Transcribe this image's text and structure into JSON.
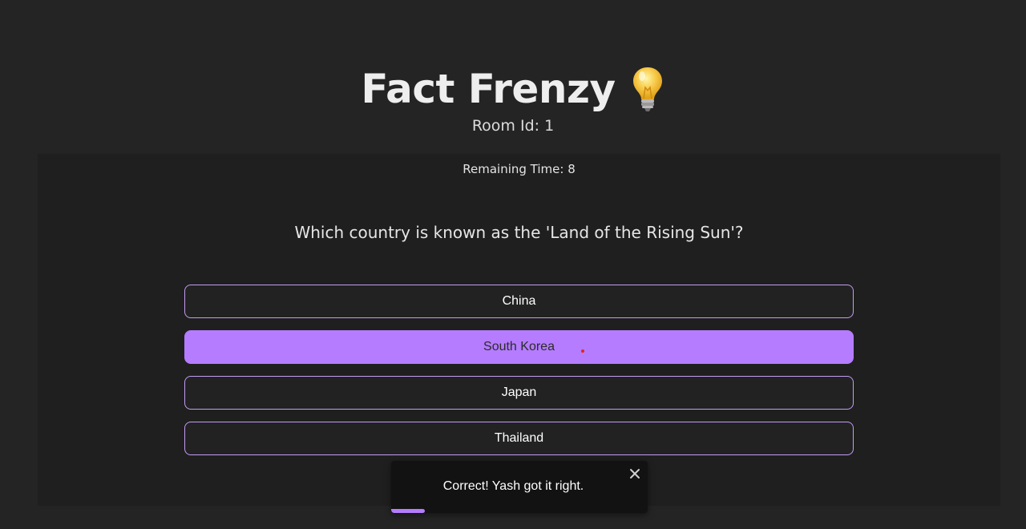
{
  "header": {
    "title": "Fact Frenzy",
    "title_icon": "lightbulb-icon",
    "room_label": "Room Id: 1"
  },
  "quiz": {
    "timer_label": "Remaining Time: 8",
    "question": "Which country is known as the 'Land of the Rising Sun'?",
    "options": [
      {
        "label": "China",
        "selected": false
      },
      {
        "label": "South Korea",
        "selected": true
      },
      {
        "label": "Japan",
        "selected": false
      },
      {
        "label": "Thailand",
        "selected": false
      }
    ]
  },
  "toast": {
    "message": "Correct! Yash got it right.",
    "close_icon": "close-icon",
    "progress_remaining": 0.13
  },
  "colors": {
    "background": "#242424",
    "panel": "#1f1f1f",
    "accent": "#b57cff",
    "toast_bg": "#121212"
  }
}
